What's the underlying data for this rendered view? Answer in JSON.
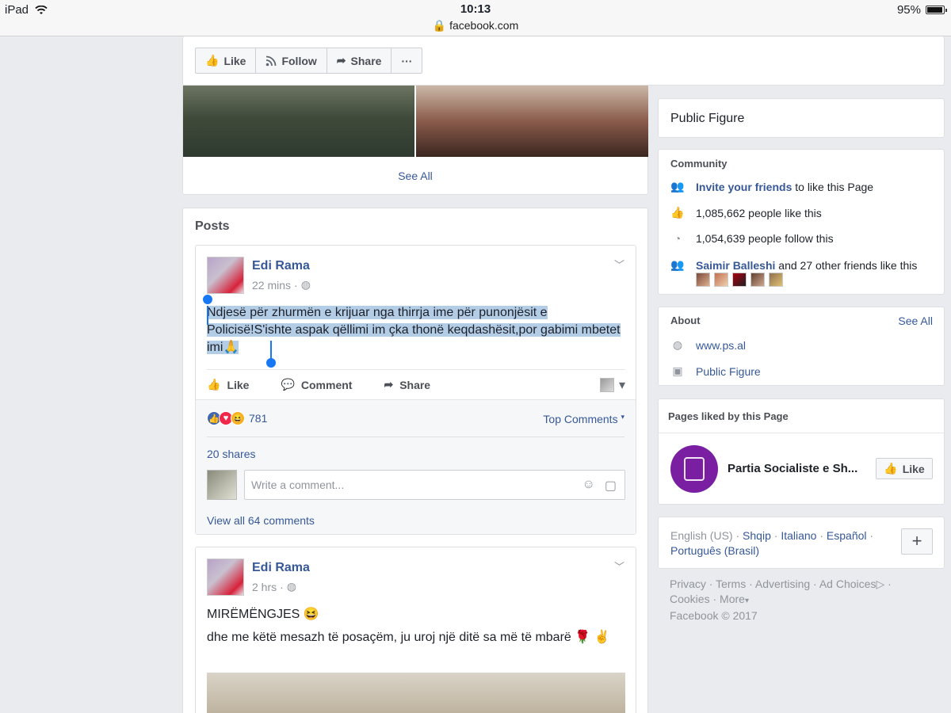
{
  "status_bar": {
    "device": "iPad",
    "time": "10:13",
    "url": "facebook.com",
    "battery": "95%",
    "battery_level": 0.95
  },
  "page_actions": {
    "like_label": "Like",
    "follow_label": "Follow",
    "share_label": "Share",
    "more_label": "···"
  },
  "photos": {
    "see_all_label": "See All"
  },
  "posts_section": {
    "title": "Posts",
    "posts": [
      {
        "author": "Edi Rama",
        "time": "22 mins",
        "privacy_icon": "globe-icon",
        "text": "Ndjesë për zhurmën e krijuar nga thirrja ime për punonjësit e Policisë!S'ishte aspak qëllimi im çka thonë keqdashësit,por gabimi mbetet imi🙏",
        "actions": {
          "like": "Like",
          "comment": "Comment",
          "share": "Share"
        },
        "reaction_count": "781",
        "top_comments_label": "Top Comments",
        "shares_label": "20 shares",
        "comment_placeholder": "Write a comment...",
        "view_all_comments": "View all 64 comments"
      },
      {
        "author": "Edi Rama",
        "time": "2 hrs",
        "privacy_icon": "globe-icon",
        "line1": "MIRËMËNGJES 😆",
        "line2": "dhe me këtë mesazh të posaçëm, ju uroj një ditë sa më të mbarë 🌹 ✌"
      }
    ]
  },
  "sidebar": {
    "category": "Public Figure",
    "community": {
      "title": "Community",
      "invite_link": "Invite your friends",
      "invite_rest": " to like this Page",
      "likes_text": "1,085,662 people like this",
      "follows_text": "1,054,639 people follow this",
      "friend_link": "Saimir Balleshi",
      "friend_rest": " and 27 other friends like this"
    },
    "about": {
      "title": "About",
      "see_all": "See All",
      "website": "www.ps.al",
      "category": "Public Figure"
    },
    "pages_liked": {
      "title": "Pages liked by this Page",
      "page_name": "Partia Socialiste e Sh...",
      "like_label": "Like"
    },
    "languages": {
      "current": "English (US)",
      "options": [
        "Shqip",
        "Italiano",
        "Español",
        "Português (Brasil)"
      ],
      "add_label": "+"
    },
    "footer": {
      "links": [
        "Privacy",
        "Terms",
        "Advertising",
        "Ad Choices",
        "Cookies",
        "More"
      ],
      "copyright": "Facebook © 2017"
    }
  },
  "colors": {
    "link": "#365899",
    "background": "#e9ebee",
    "selection": "#b4cde6",
    "selection_handle": "#1877f2",
    "page_logo": "#7b1fa2"
  }
}
